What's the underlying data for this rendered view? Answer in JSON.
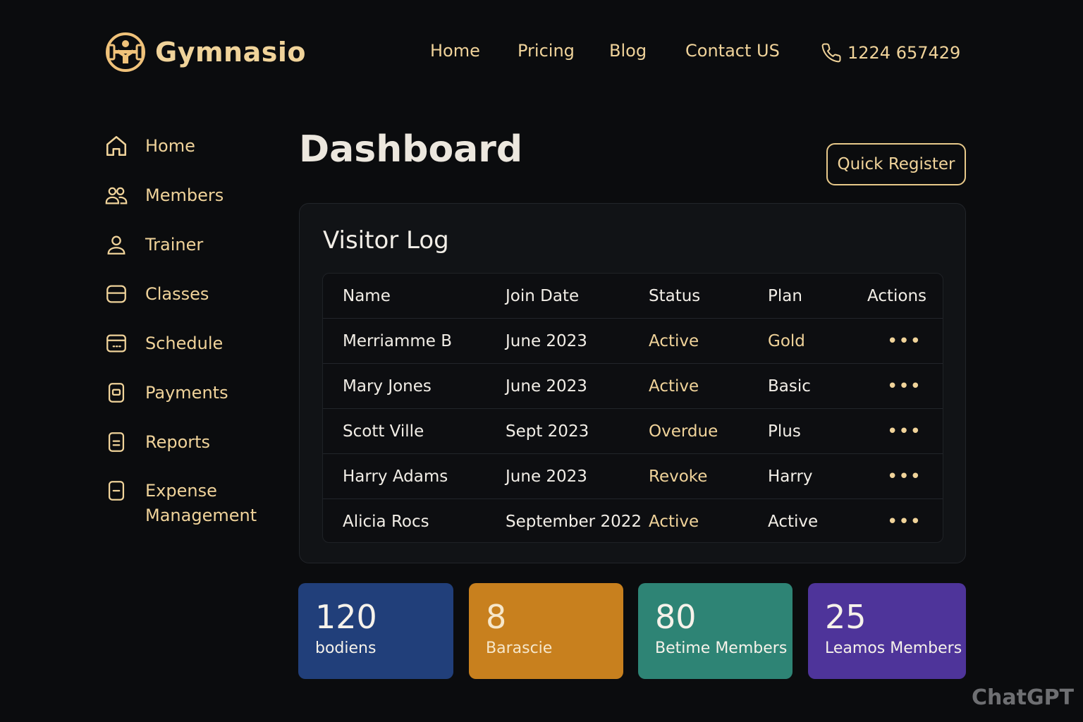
{
  "brand": {
    "name": "Gymnasio"
  },
  "topnav": {
    "items": [
      {
        "label": "Home"
      },
      {
        "label": "Pricing"
      },
      {
        "label": "Blog"
      },
      {
        "label": "Contact US"
      }
    ],
    "phone": "1224 657429"
  },
  "sidebar": {
    "items": [
      {
        "label": "Home",
        "icon": "home-icon"
      },
      {
        "label": "Members",
        "icon": "members-icon"
      },
      {
        "label": "Trainer",
        "icon": "user-icon"
      },
      {
        "label": "Classes",
        "icon": "classes-icon"
      },
      {
        "label": "Schedule",
        "icon": "calendar-icon"
      },
      {
        "label": "Payments",
        "icon": "payment-icon"
      },
      {
        "label": "Reports",
        "icon": "report-icon"
      },
      {
        "label": "Expense Management",
        "icon": "expense-icon"
      }
    ]
  },
  "main": {
    "title": "Dashboard",
    "quick_register": "Quick Register",
    "visitor_log": {
      "title": "Visitor Log",
      "columns": [
        "Name",
        "Join Date",
        "Status",
        "Plan",
        "Actions"
      ],
      "rows": [
        {
          "name": "Merriamme B",
          "date": "June 2023",
          "status": "Active",
          "plan": "Gold",
          "actions": "•••"
        },
        {
          "name": "Mary Jones",
          "date": "June 2023",
          "status": "Active",
          "plan": "Basic",
          "actions": "•••"
        },
        {
          "name": "Scott Ville",
          "date": "Sept 2023",
          "status": "Overdue",
          "plan": "Plus",
          "actions": "•••"
        },
        {
          "name": "Harry Adams",
          "date": "June 2023",
          "status": "Revoke",
          "plan": "Harry",
          "actions": "•••"
        },
        {
          "name": "Alicia Rocs",
          "date": "September 2022",
          "status": "Active",
          "plan": "Active",
          "actions": "•••"
        }
      ]
    },
    "stats": [
      {
        "value": "120",
        "label": "bodiens",
        "color": "#213f7a"
      },
      {
        "value": "8",
        "label": "Barascie",
        "color": "#c8801e"
      },
      {
        "value": "80",
        "label": "Betime Members",
        "color": "#2e8475"
      },
      {
        "value": "25",
        "label": "Leamos Members",
        "color": "#4e349a"
      }
    ]
  },
  "watermark": "ChatGPT",
  "colors": {
    "accent": "#f0d39a",
    "background": "#0b0c0e",
    "card": "#111316"
  }
}
